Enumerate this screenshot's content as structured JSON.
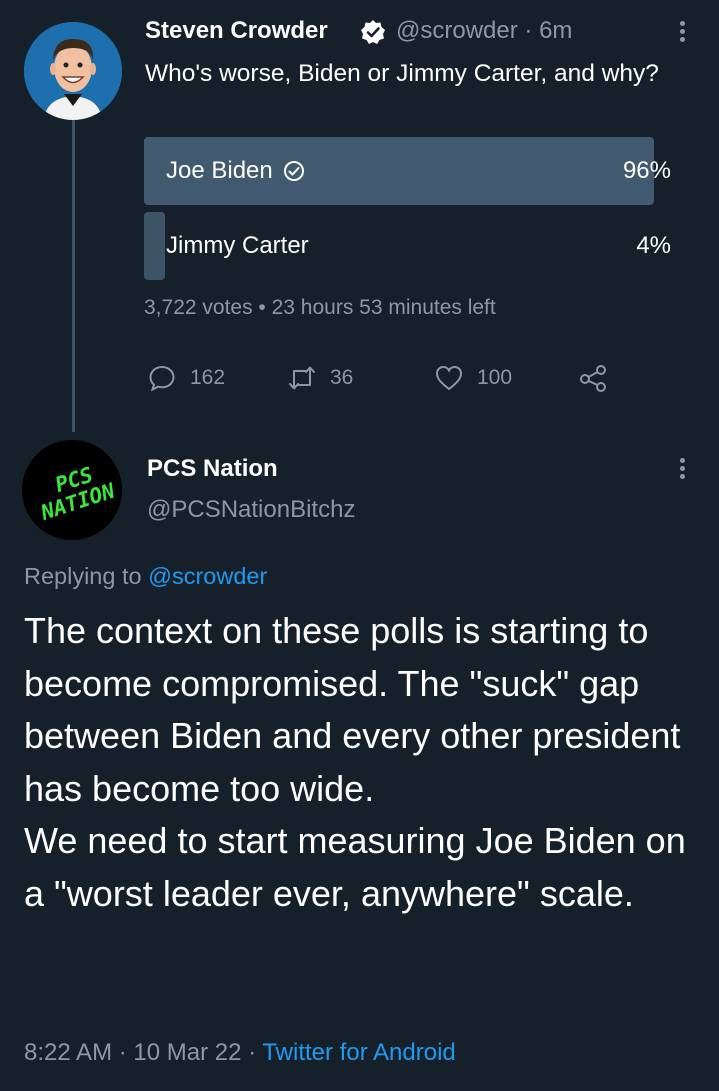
{
  "tweet1": {
    "name": "Steven Crowder",
    "handle": "@scrowder",
    "time": "· 6m",
    "text": "Who's worse, Biden or Jimmy Carter, and why?",
    "poll": {
      "options": [
        {
          "label": "Joe Biden",
          "percent_label": "96%",
          "percent": 96,
          "selected": true
        },
        {
          "label": "Jimmy Carter",
          "percent_label": "4%",
          "percent": 4,
          "selected": false
        }
      ],
      "meta": "3,722 votes • 23 hours 53 minutes left"
    },
    "actions": {
      "replies": "162",
      "retweets": "36",
      "likes": "100"
    }
  },
  "tweet2": {
    "name": "PCS Nation",
    "handle": "@PCSNationBitchz",
    "avatar_text": [
      "PCS",
      "NATION"
    ],
    "replying_prefix": "Replying to ",
    "replying_to": "@scrowder",
    "text_lines": [
      "The context on these polls is starting to become compromised. The \"suck\" gap between Biden and every other president has become too wide.",
      "We need to start measuring Joe Biden on a \"worst leader ever, anywhere\" scale."
    ],
    "timestamp": "8:22 AM · 10 Mar 22 · ",
    "source": "Twitter for Android"
  },
  "icons": [
    "verified-badge-icon",
    "more-options-icon",
    "check-circle-icon",
    "reply-icon",
    "retweet-icon",
    "like-icon",
    "share-icon"
  ],
  "colors": {
    "background": "#15202b",
    "secondary_text": "#8b98a5",
    "link": "#1d9bf0",
    "poll_bar": "#415a6f",
    "thread_line": "#3d5466",
    "pcs_green": "#39e639"
  }
}
